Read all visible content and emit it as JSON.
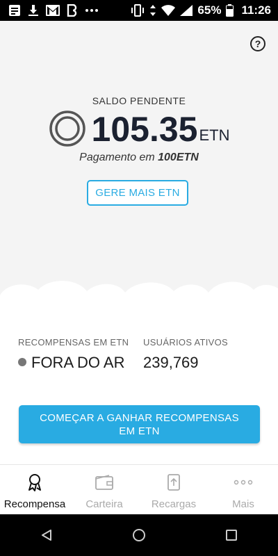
{
  "status_bar": {
    "battery_text": "65%",
    "time": "11:26",
    "icons": [
      "message-icon",
      "download-icon",
      "gmail-icon",
      "b-app-icon",
      "more-dots-icon",
      "vibrate-icon",
      "data-arrows-icon",
      "wifi-icon",
      "signal-icon",
      "battery-icon"
    ]
  },
  "header": {
    "help_label": "?"
  },
  "balance": {
    "label": "SALDO PENDENTE",
    "value": "105.35",
    "unit": "ETN",
    "payout_prefix": "Pagamento em ",
    "payout_amount": "100ETN",
    "earn_more_label": "GERE MAIS ETN"
  },
  "stats": {
    "rewards_label": "RECOMPENSAS EM ETN",
    "rewards_status": "FORA DO AR",
    "users_label": "USUÁRIOS ATIVOS",
    "users_value": "239,769"
  },
  "cta": {
    "start_label": "COMEÇAR A GANHAR RECOMPENSAS EM ETN"
  },
  "tabs": [
    {
      "label": "Recompensa",
      "icon": "award-icon",
      "active": true
    },
    {
      "label": "Carteira",
      "icon": "wallet-icon",
      "active": false
    },
    {
      "label": "Recargas",
      "icon": "topup-icon",
      "active": false
    },
    {
      "label": "Mais",
      "icon": "more-icon",
      "active": false
    }
  ],
  "colors": {
    "accent": "#29abe2",
    "text_dark": "#1b2130",
    "background_top": "#f4f4f4",
    "status_dot": "#777777"
  }
}
